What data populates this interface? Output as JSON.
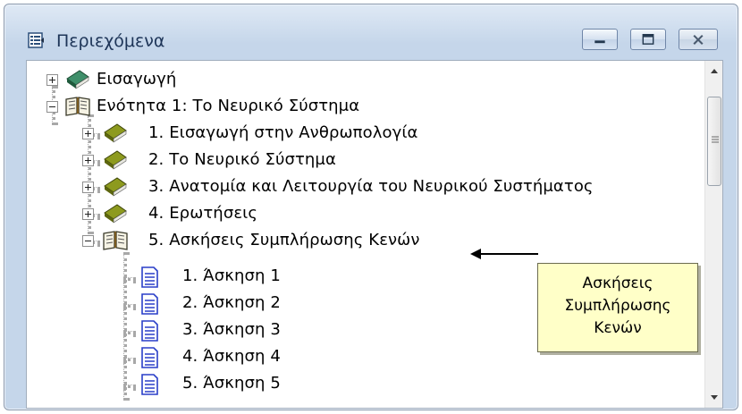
{
  "window": {
    "title": "Περιεχόμενα",
    "buttons": {
      "minimize": "minimize",
      "maximize": "maximize",
      "close": "close"
    }
  },
  "tree": {
    "nodes": [
      {
        "label": "Εισαγωγή",
        "icon": "closed-book-icon",
        "expander": "plus"
      },
      {
        "label": "Ενότητα   1:  Το Νευρικό Σύστημα",
        "icon": "open-book-icon",
        "expander": "minus"
      },
      {
        "label": "1.  Εισαγωγή στην Ανθρωπολογία",
        "icon": "closed-book-icon",
        "expander": "plus"
      },
      {
        "label": "2.  Το Νευρικό Σύστημα",
        "icon": "closed-book-icon",
        "expander": "plus"
      },
      {
        "label": "3.  Ανατομία και Λειτουργία του Νευρικού Συστήματος",
        "icon": "closed-book-icon",
        "expander": "plus"
      },
      {
        "label": "4.  Ερωτήσεις",
        "icon": "closed-book-icon",
        "expander": "plus"
      },
      {
        "label": "5.  Ασκήσεις Συμπλήρωσης Κενών",
        "icon": "open-book-icon",
        "expander": "minus"
      },
      {
        "label": "1.  Άσκηση  1",
        "icon": "page-icon"
      },
      {
        "label": "2.  Άσκηση  2",
        "icon": "page-icon"
      },
      {
        "label": "3.  Άσκηση  3",
        "icon": "page-icon"
      },
      {
        "label": "4.  Άσκηση  4",
        "icon": "page-icon"
      },
      {
        "label": "5.  Άσκηση  5",
        "icon": "page-icon"
      }
    ]
  },
  "callout": {
    "lines": [
      "Ασκήσεις",
      "Συμπλήρωσης",
      "Κενών"
    ]
  },
  "colors": {
    "book_green": "#2f6b4a",
    "book_olive": "#6f7a12",
    "page_blue": "#2a3fc8",
    "callout_bg": "#ffffc8"
  }
}
